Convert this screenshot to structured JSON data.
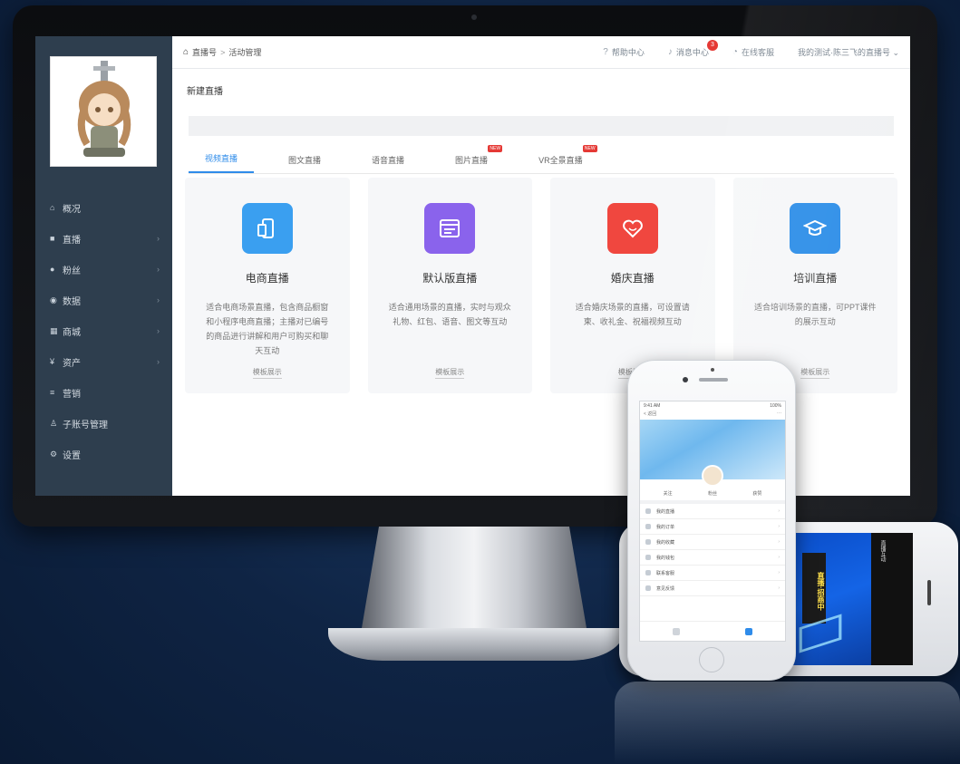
{
  "breadcrumb": {
    "home": "直播号",
    "separator": ">",
    "current": "活动管理"
  },
  "topbar": {
    "help": "帮助中心",
    "messages": "消息中心",
    "messages_badge": "3",
    "service": "在线客服",
    "account": "我的测试·陈三飞的直播号 ⌄"
  },
  "sidebar": {
    "items": [
      {
        "icon": "home-icon",
        "label": "概况",
        "has_children": false
      },
      {
        "icon": "video-icon",
        "label": "直播",
        "has_children": true
      },
      {
        "icon": "user-icon",
        "label": "粉丝",
        "has_children": true
      },
      {
        "icon": "eye-icon",
        "label": "数据",
        "has_children": true
      },
      {
        "icon": "grid-icon",
        "label": "商城",
        "has_children": true
      },
      {
        "icon": "asset-icon",
        "label": "资产",
        "has_children": true
      },
      {
        "icon": "list-icon",
        "label": "营销",
        "has_children": false
      },
      {
        "icon": "person-icon",
        "label": "子账号管理",
        "has_children": false
      },
      {
        "icon": "settings-icon",
        "label": "设置",
        "has_children": false
      }
    ]
  },
  "page": {
    "title": "新建直播"
  },
  "tabs": [
    {
      "label": "视频直播",
      "active": true,
      "new": false
    },
    {
      "label": "图文直播",
      "active": false,
      "new": false
    },
    {
      "label": "语音直播",
      "active": false,
      "new": false
    },
    {
      "label": "图片直播",
      "active": false,
      "new": true
    },
    {
      "label": "VR全景直播",
      "active": false,
      "new": true
    }
  ],
  "tab_new_label": "NEW",
  "cards": [
    {
      "title": "电商直播",
      "color": "#3a9ff0",
      "icon": "phone-icon",
      "desc": "适合电商场景直播，包含商品橱窗和小程序电商直播；主播对已编号的商品进行讲解和用户可购买和聊天互动",
      "link": "模板展示"
    },
    {
      "title": "默认版直播",
      "color": "#8a63ec",
      "icon": "browser-icon",
      "desc": "适合通用场景的直播，实时与观众礼物、红包、语音、图文等互动",
      "link": "模板展示"
    },
    {
      "title": "婚庆直播",
      "color": "#f0473f",
      "icon": "heart-icon",
      "desc": "适合婚庆场景的直播，可设置请柬、收礼金、祝福视频互动",
      "link": "模板展示"
    },
    {
      "title": "培训直播",
      "color": "#2d8ee8",
      "icon": "graduation-cap-icon",
      "desc": "适合培训场景的直播，可PPT课件的展示互动",
      "link": "模板展示"
    }
  ],
  "phone": {
    "status_left": "9:41 AM",
    "status_right": "100%",
    "header_left": "< 返回",
    "header_right": "···",
    "stats": [
      "关注",
      "粉丝",
      "获赞"
    ],
    "list": [
      "我的直播",
      "我的订单",
      "我的收藏",
      "我的钱包",
      "联系客服",
      "意见反馈"
    ]
  },
  "landscape_phone": {
    "banner": "直播·招商中",
    "side_text": "直播互动"
  }
}
